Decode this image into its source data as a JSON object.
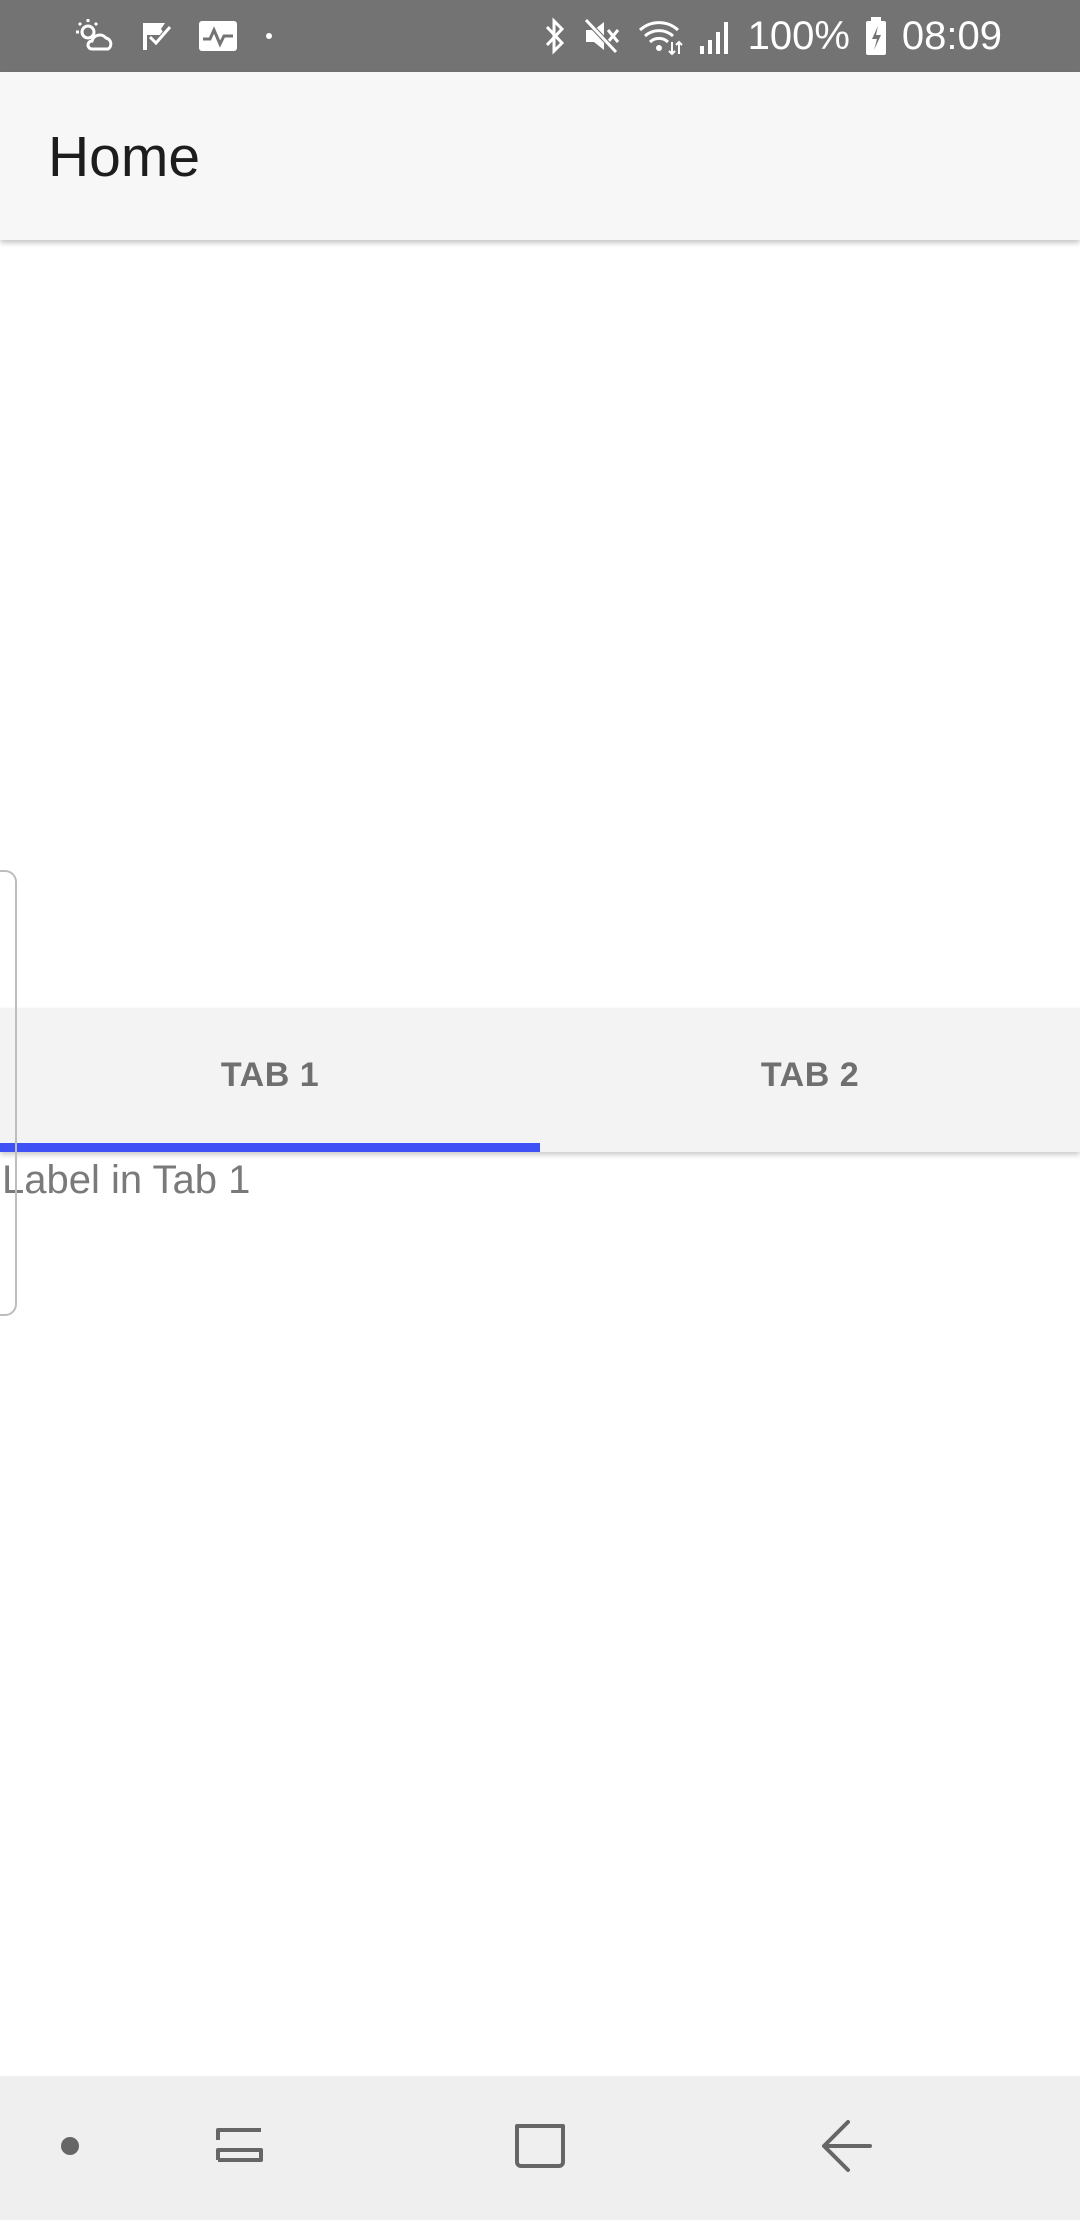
{
  "status_bar": {
    "battery": "100%",
    "time": "08:09",
    "left_icons": [
      "weather-icon",
      "task-check-icon",
      "activity-icon",
      "dot-icon"
    ],
    "right_icons": [
      "bluetooth-icon",
      "mute-icon",
      "wifi-icon",
      "signal-icon",
      "battery-icon"
    ]
  },
  "app_bar": {
    "title": "Home"
  },
  "tabs": [
    {
      "label": "TAB 1",
      "selected": true
    },
    {
      "label": "TAB 2",
      "selected": false
    }
  ],
  "content": {
    "label": "Label in Tab 1"
  },
  "nav_bar": {
    "buttons": [
      "dot-icon",
      "recent-apps-icon",
      "home-icon",
      "back-icon"
    ]
  },
  "colors": {
    "status_bar_bg": "#737373",
    "app_bar_bg": "#f7f7f7",
    "tab_bar_bg": "#f3f3f3",
    "tab_indicator": "#3f51f5",
    "nav_bar_bg": "#efefef",
    "title_text": "#1d1d1d",
    "tab_text": "#6f6f6f"
  }
}
